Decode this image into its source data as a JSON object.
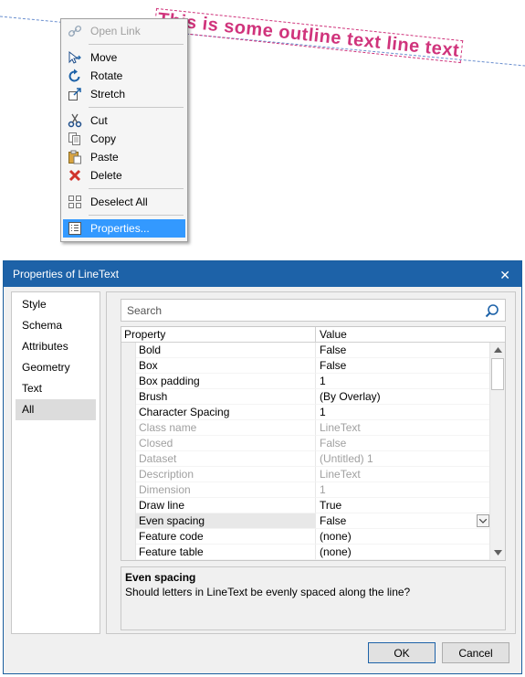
{
  "canvas": {
    "outline_text": "This is some outline text line text",
    "text_color": "#d0347c"
  },
  "context_menu": {
    "items": [
      {
        "label": "Open Link",
        "icon": "link-icon",
        "disabled": true
      },
      {
        "label": "Move",
        "icon": "move-icon"
      },
      {
        "label": "Rotate",
        "icon": "rotate-icon"
      },
      {
        "label": "Stretch",
        "icon": "stretch-icon"
      },
      {
        "label": "Cut",
        "icon": "cut-icon"
      },
      {
        "label": "Copy",
        "icon": "copy-icon"
      },
      {
        "label": "Paste",
        "icon": "paste-icon"
      },
      {
        "label": "Delete",
        "icon": "delete-icon"
      },
      {
        "label": "Deselect All",
        "icon": "deselect-all-icon"
      },
      {
        "label": "Properties...",
        "icon": "properties-icon",
        "selected": true
      }
    ]
  },
  "dialog": {
    "title": "Properties of LineText",
    "close_icon": "close-icon",
    "nav": [
      "Style",
      "Schema",
      "Attributes",
      "Geometry",
      "Text",
      "All"
    ],
    "nav_active": "All",
    "search_placeholder": "Search",
    "grid": {
      "col_property": "Property",
      "col_value": "Value",
      "rows": [
        {
          "name": "Bold",
          "value": "False"
        },
        {
          "name": "Box",
          "value": "False"
        },
        {
          "name": "Box padding",
          "value": "1"
        },
        {
          "name": "Brush",
          "value": " (By Overlay)"
        },
        {
          "name": "Character Spacing",
          "value": "1"
        },
        {
          "name": "Class name",
          "value": "LineText",
          "readonly": true
        },
        {
          "name": "Closed",
          "value": "False",
          "readonly": true
        },
        {
          "name": "Dataset",
          "value": "(Untitled) 1",
          "readonly": true
        },
        {
          "name": "Description",
          "value": "LineText",
          "readonly": true
        },
        {
          "name": "Dimension",
          "value": "1",
          "readonly": true
        },
        {
          "name": "Draw line",
          "value": "True"
        },
        {
          "name": "Even spacing",
          "value": "False",
          "selected": true
        },
        {
          "name": "Feature code",
          "value": " (none)"
        },
        {
          "name": "Feature table",
          "value": " (none)"
        }
      ]
    },
    "description": {
      "title": "Even spacing",
      "body": "Should letters in LineText be evenly spaced along the line?"
    },
    "ok_label": "OK",
    "cancel_label": "Cancel",
    "accent": "#1d62a8"
  }
}
